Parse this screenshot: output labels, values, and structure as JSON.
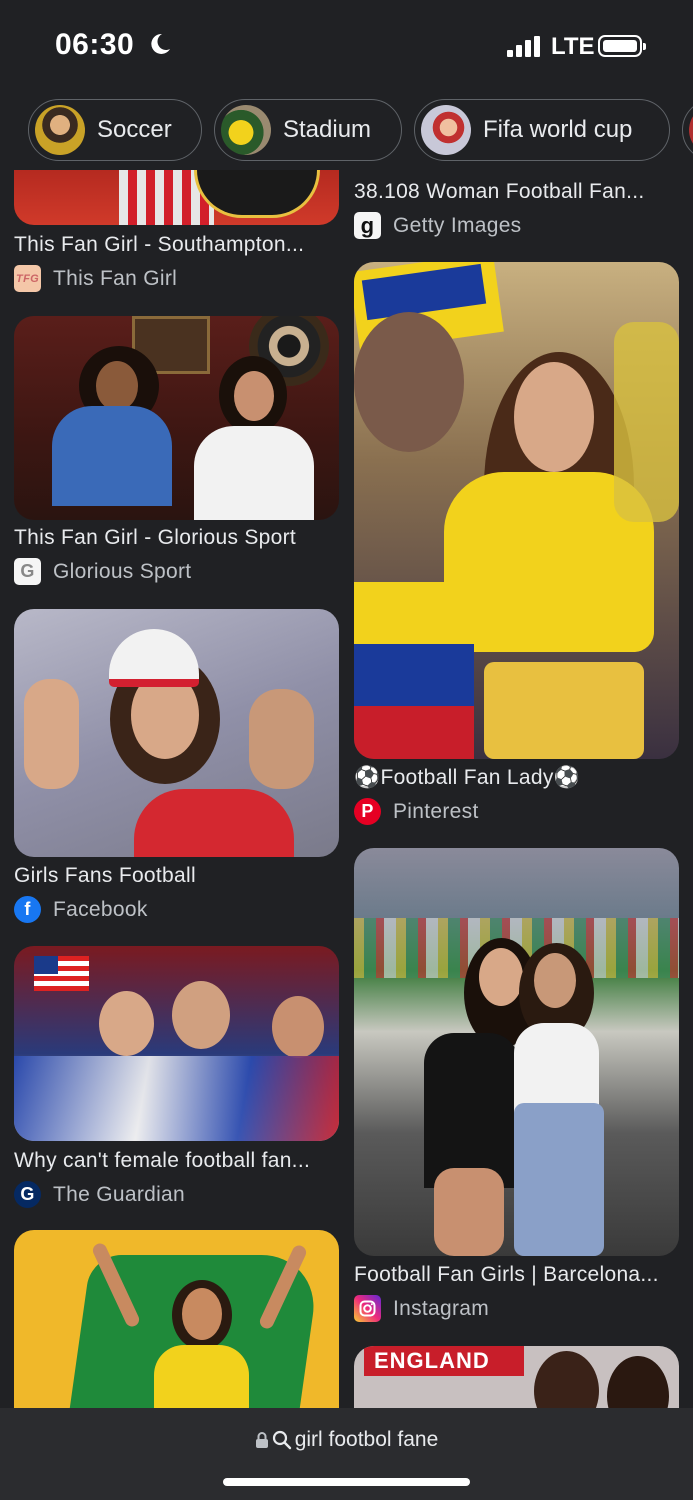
{
  "status_bar": {
    "time": "06:30",
    "network": "LTE"
  },
  "chips": [
    {
      "label": "Soccer"
    },
    {
      "label": "Stadium"
    },
    {
      "label": "Fifa world cup"
    }
  ],
  "results": [
    {
      "title": "This Fan Girl - Southampton...",
      "source": "This Fan Girl",
      "source_icon": "TFG"
    },
    {
      "title": "This Fan Girl - Glorious Sport",
      "source": "Glorious Sport",
      "source_icon": "G"
    },
    {
      "title": "Girls Fans Football",
      "source": "Facebook",
      "source_icon": "f"
    },
    {
      "title": "Why can't female football fan...",
      "source": "The Guardian",
      "source_icon": "G"
    },
    {
      "title": "38.108 Woman Football Fan...",
      "source": "Getty Images",
      "source_icon": "g"
    },
    {
      "title": "⚽Football Fan Lady⚽",
      "source": "Pinterest",
      "source_icon": "P"
    },
    {
      "title": "Football Fan Girls | Barcelona...",
      "source": "Instagram",
      "source_icon": "ig"
    }
  ],
  "address_bar": {
    "query": "girl footbol fane"
  },
  "colors": {
    "background": "#202124",
    "pinterest": "#e60023",
    "facebook": "#1877f2",
    "guardian": "#052962"
  }
}
